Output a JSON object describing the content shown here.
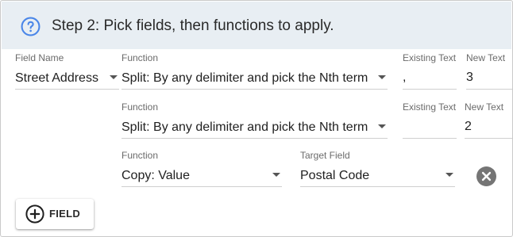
{
  "header": {
    "title": "Step 2: Pick fields, then functions to apply."
  },
  "labels": {
    "field_name": "Field Name",
    "function": "Function",
    "existing_text": "Existing Text",
    "new_text": "New Text",
    "target_field": "Target Field"
  },
  "rows": [
    {
      "field_name": "Street Address",
      "function": "Split: By any delimiter and pick the Nth term",
      "existing_text": ",",
      "new_text": "3"
    },
    {
      "function": "Split: By any delimiter and pick the Nth term",
      "existing_text": "",
      "new_text": "2"
    },
    {
      "function": "Copy: Value",
      "target_field": "Postal Code"
    }
  ],
  "buttons": {
    "add_field": "FIELD"
  },
  "colors": {
    "header_bg": "#e8eef3",
    "help_icon": "#4a86e8",
    "remove_icon": "#757575"
  },
  "icons": {
    "help": "help-circle-icon",
    "remove": "close-circle-icon",
    "add": "plus-circle-icon",
    "dropdown": "caret-down-icon"
  }
}
